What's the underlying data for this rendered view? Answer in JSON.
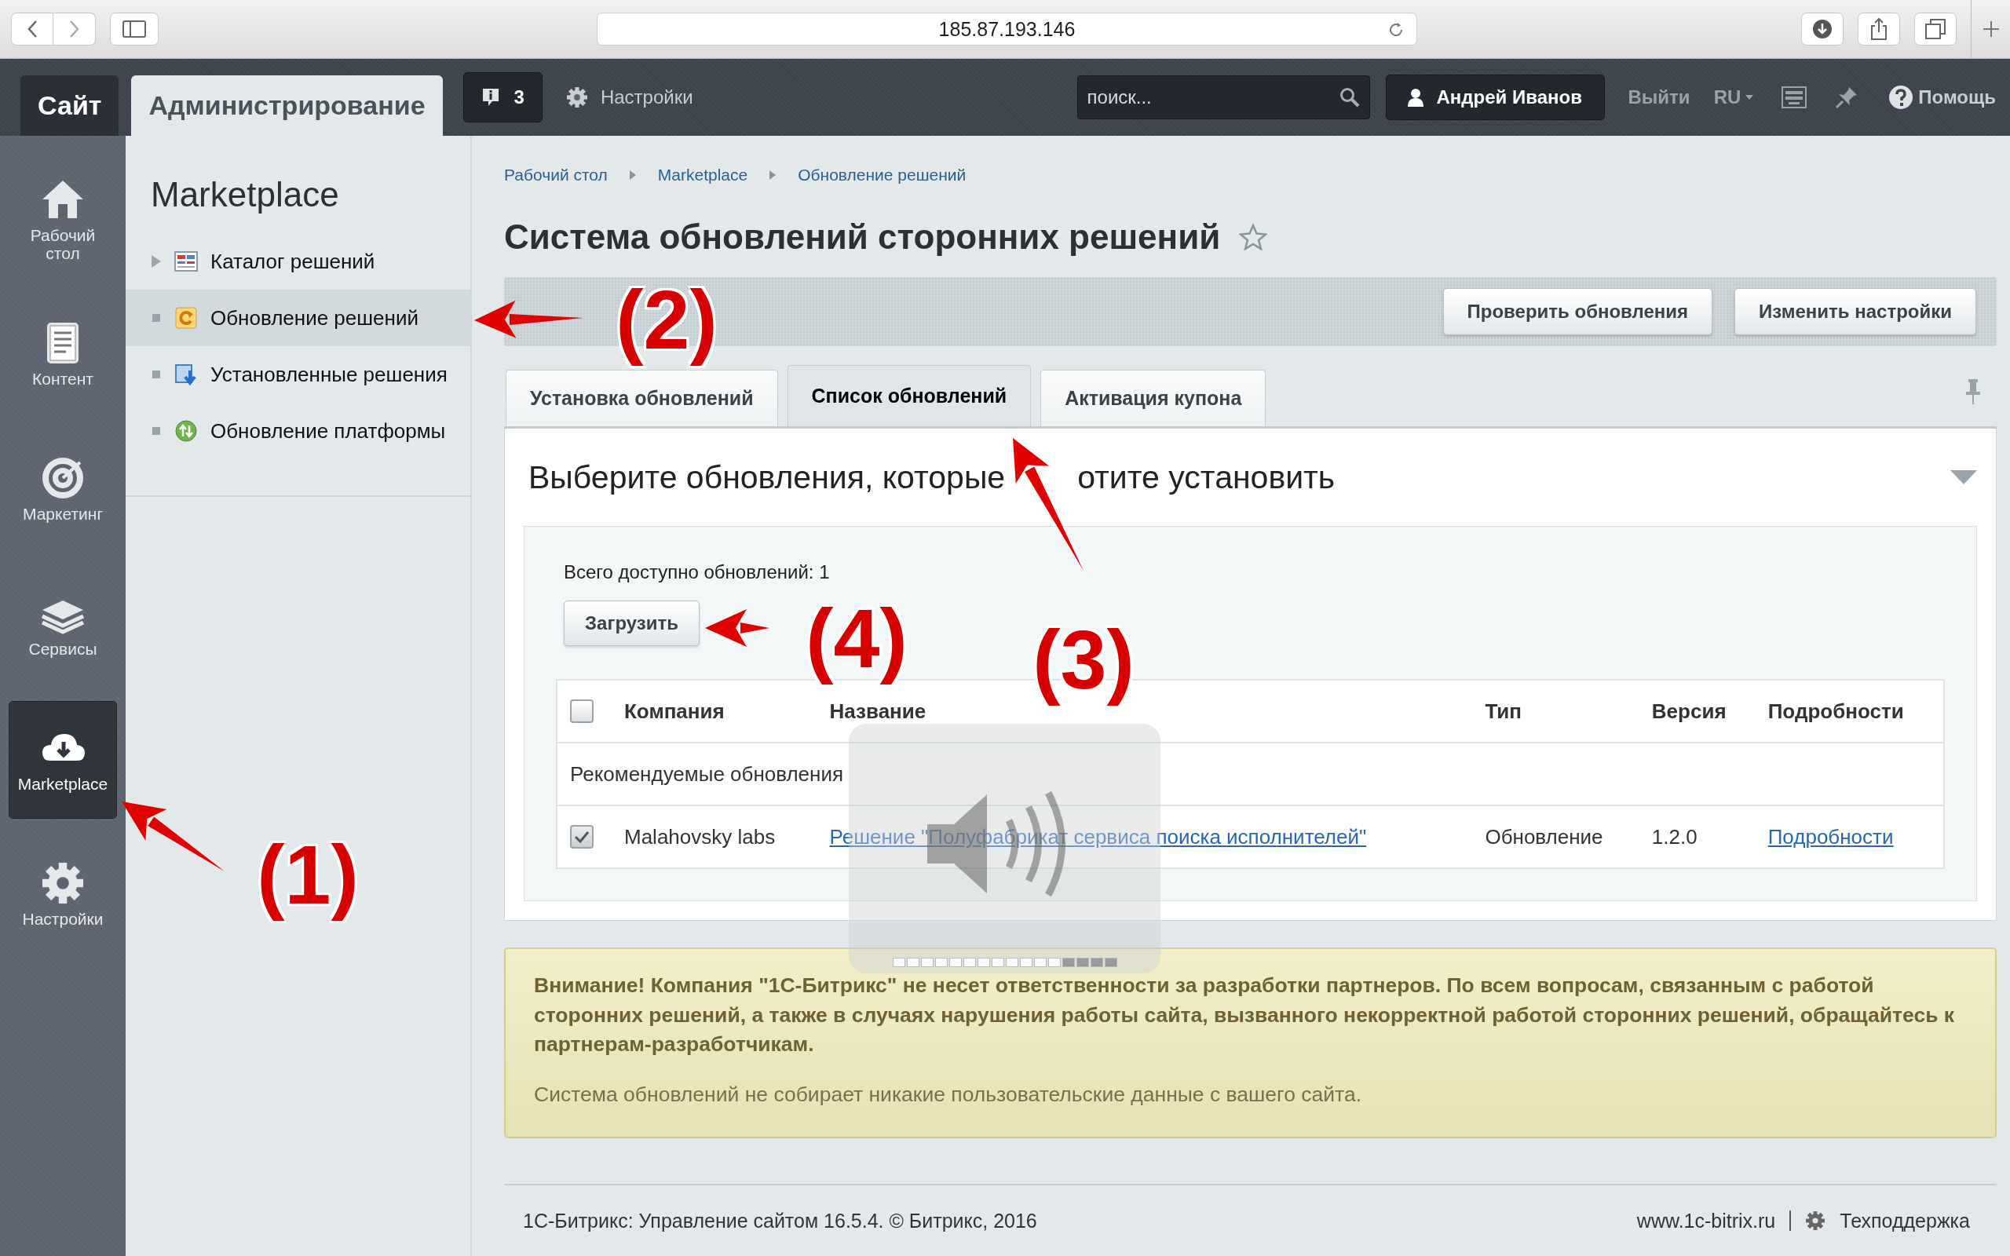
{
  "browser": {
    "url": "185.87.193.146"
  },
  "header": {
    "tabs": [
      {
        "label": "Сайт",
        "selected": false
      },
      {
        "label": "Администрирование",
        "selected": true
      }
    ],
    "notifications": "3",
    "settings": "Настройки",
    "search": {
      "placeholder": "поиск..."
    },
    "user": "Андрей Иванов",
    "logout": "Выйти",
    "language": "RU",
    "help": "Помощь"
  },
  "main_menu": [
    {
      "label": "Рабочий стол",
      "selected": false
    },
    {
      "label": "Контент",
      "selected": false
    },
    {
      "label": "Маркетинг",
      "selected": false
    },
    {
      "label": "Сервисы",
      "selected": false
    },
    {
      "label": "Marketplace",
      "selected": true
    },
    {
      "label": "Настройки",
      "selected": false
    }
  ],
  "section_menu": {
    "title": "Marketplace",
    "items": [
      {
        "label": "Каталог решений",
        "has_children": true,
        "selected": false
      },
      {
        "label": "Обновление решений",
        "has_children": false,
        "selected": true
      },
      {
        "label": "Установленные решения",
        "has_children": false,
        "selected": false
      },
      {
        "label": "Обновление платформы",
        "has_children": false,
        "selected": false
      }
    ]
  },
  "breadcrumbs": [
    "Рабочий стол",
    "Marketplace",
    "Обновление решений"
  ],
  "title": "Система обновлений сторонних решений",
  "toolbar_buttons": [
    "Проверить обновления",
    "Изменить настройки"
  ],
  "tabs": [
    {
      "label": "Установка обновлений",
      "selected": false
    },
    {
      "label": "Список обновлений",
      "selected": true
    },
    {
      "label": "Активация купона",
      "selected": false
    }
  ],
  "panel": {
    "heading": [
      "Выберите обновления, которые",
      "отите установить"
    ],
    "total": "Всего доступно обновлений: 1",
    "load_button": "Загрузить",
    "table": {
      "select_all": {
        "checked": false
      },
      "columns": [
        "Компания",
        "Название",
        "Тип",
        "Версия",
        "Подробности"
      ],
      "groups": [
        {
          "title": "Рекомендуемые обновления",
          "rows": [
            {
              "checked": true,
              "company": "Malahovsky labs",
              "name": "Решение \"Полуфабрикат сервиса поиска исполнителей\"",
              "type": "Обновление",
              "version": "1.2.0",
              "details": "Подробности"
            }
          ]
        }
      ]
    }
  },
  "notice": {
    "warning": "Внимание! Компания \"1С-Битрикс\" не несет ответственности за разработки партнеров. По всем вопросам, связанным с работой сторонних решений, а также в случаях нарушения работы сайта, вызванного некорректной работой сторонних решений, обращайтесь к партнерам-разработчикам.",
    "info": "Система обновлений не собирает никакие пользовательские данные с вашего сайта."
  },
  "footer": {
    "copyright": "1С-Битрикс: Управление сайтом 16.5.4. © Битрикс, 2016",
    "site": "www.1c-bitrix.ru",
    "support": "Техподдержка"
  },
  "annotations": [
    {
      "label": "(1)"
    },
    {
      "label": "(2)"
    },
    {
      "label": "(3)"
    },
    {
      "label": "(4)"
    }
  ]
}
